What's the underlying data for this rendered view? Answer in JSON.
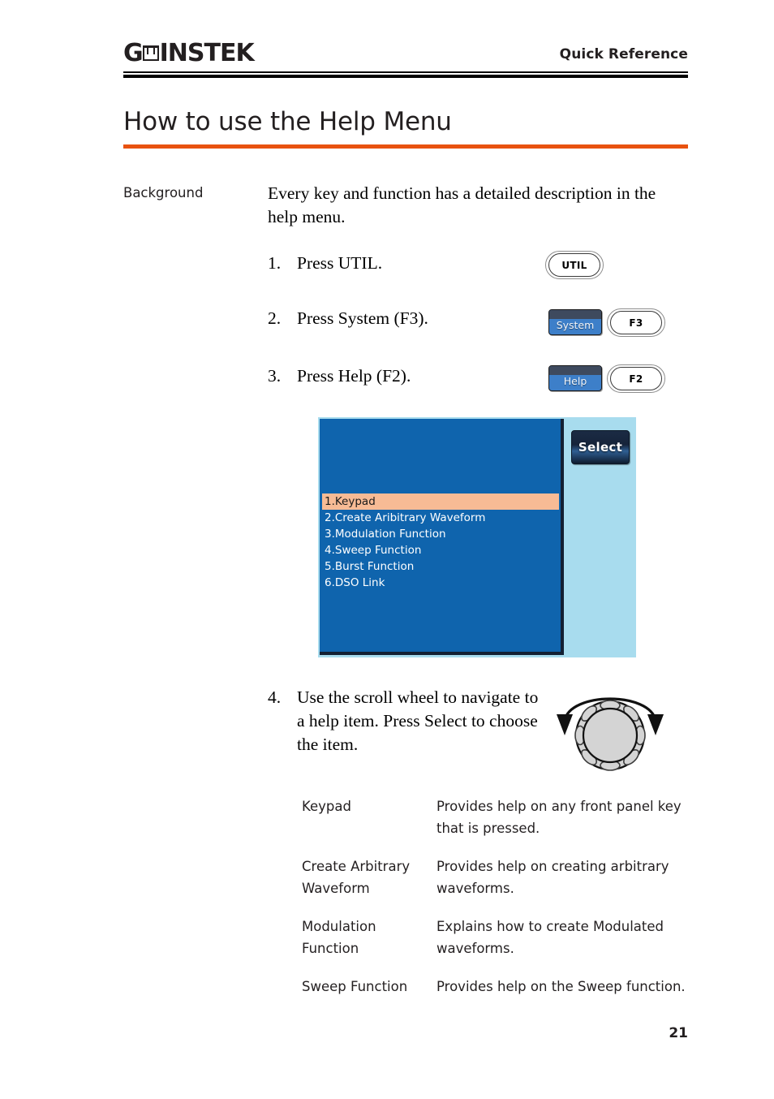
{
  "header": {
    "logo_gw": "G",
    "logo_instek": "INSTEK",
    "right_title": "Quick Reference"
  },
  "title": "How to use the Help Menu",
  "background": {
    "label": "Background",
    "text": "Every key and function has a detailed description in the help menu."
  },
  "steps": [
    {
      "num": "1.",
      "text": "Press UTIL."
    },
    {
      "num": "2.",
      "text": "Press System (F3)."
    },
    {
      "num": "3.",
      "text": "Press Help (F2)."
    },
    {
      "num": "4.",
      "text": "Use the scroll wheel to navigate to a help item. Press Select to choose the item."
    }
  ],
  "keys": {
    "util": "UTIL",
    "system_soft": "System",
    "f3": "F3",
    "help_soft": "Help",
    "f2": "F2"
  },
  "screenshot": {
    "select_button": "Select",
    "menu_items": [
      "1.Keypad",
      "2.Create Aribitrary Waveform",
      "3.Modulation Function",
      "4.Sweep Function",
      "5.Burst Function",
      "6.DSO Link"
    ],
    "selected_index": 0,
    "colors": {
      "screen_blue": "#0f64ad",
      "sidebar_blue": "#a8dcee",
      "highlight_peach": "#f7bb95",
      "bezel_navy": "#132033"
    }
  },
  "descriptions": [
    {
      "term": "Keypad",
      "definition": "Provides help on any front panel key that is pressed."
    },
    {
      "term": "Create Arbitrary Waveform",
      "definition": "Provides help on creating arbitrary waveforms."
    },
    {
      "term": "Modulation Function",
      "definition": "Explains how to create Modulated waveforms."
    },
    {
      "term": "Sweep Function",
      "definition": "Provides help on the Sweep function."
    }
  ],
  "footer": {
    "page_number": "21"
  },
  "colors": {
    "accent_orange": "#e8520f",
    "ink": "#231f20",
    "softkey_blue": "#3d7fc9",
    "softkey_band": "#3e4a5e"
  }
}
